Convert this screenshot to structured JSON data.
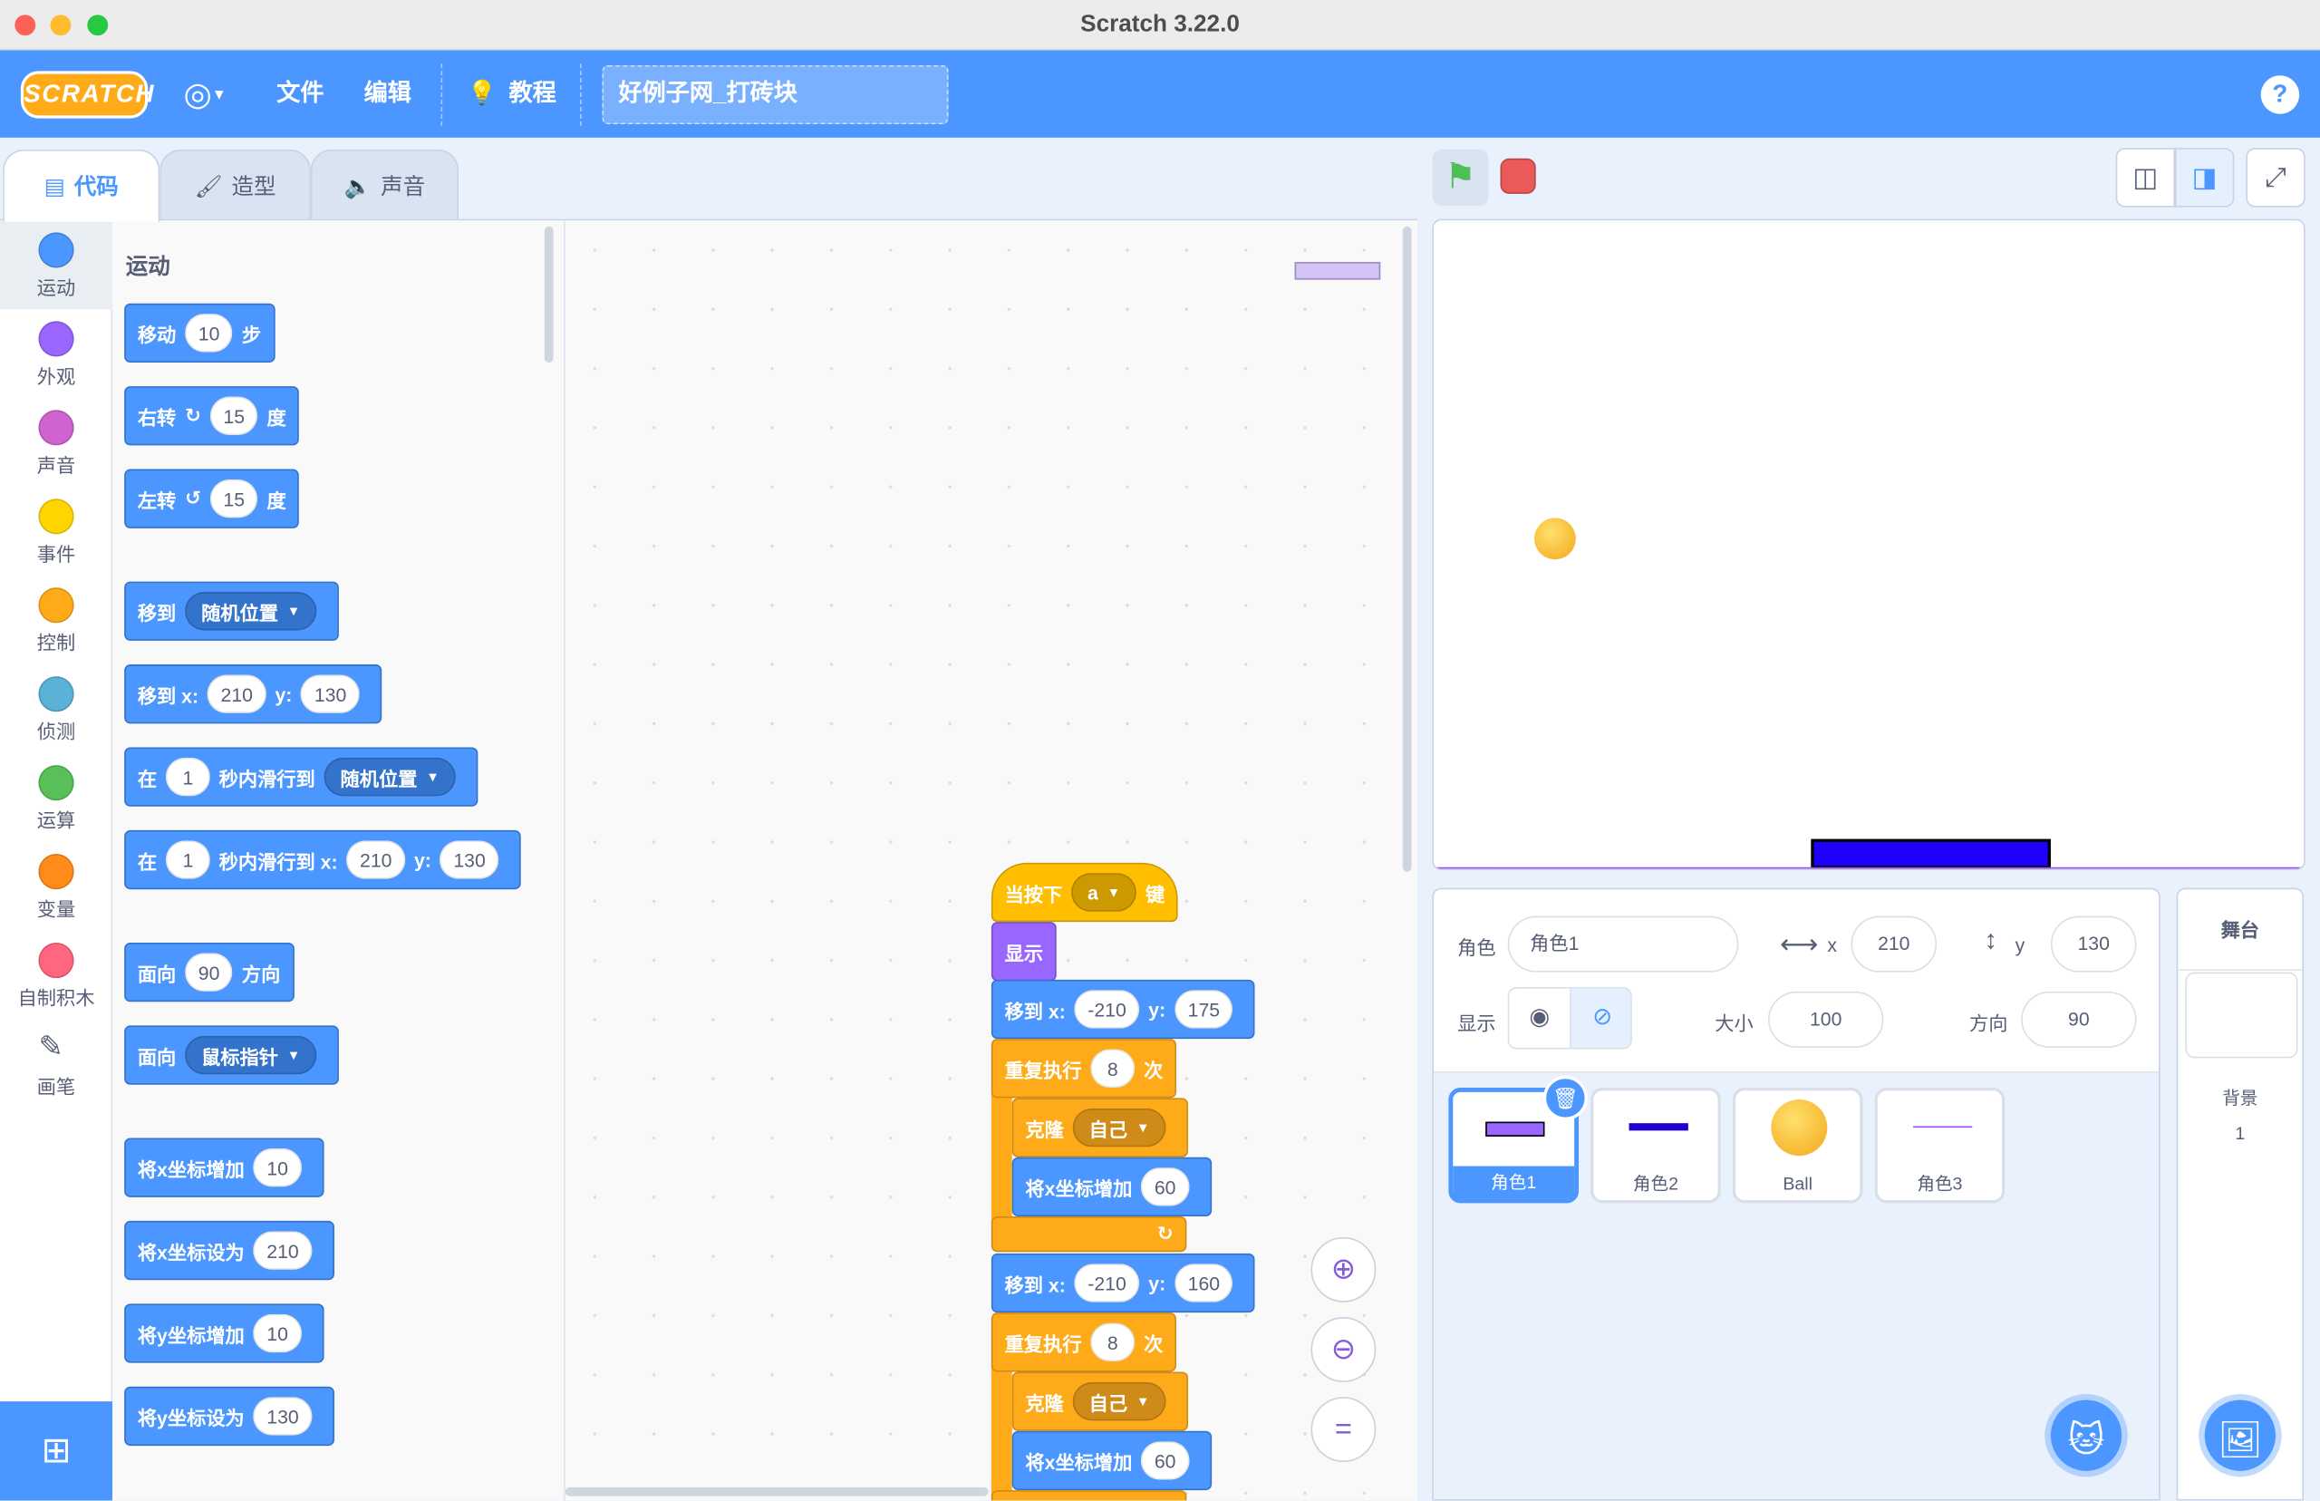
{
  "window": {
    "title": "Scratch 3.22.0"
  },
  "menu": {
    "logo": "SCRATCH",
    "globe_icon": "globe-icon",
    "file": "文件",
    "edit": "编辑",
    "tutorials": "教程",
    "project_title": "好例子网_打砖块",
    "help": "?"
  },
  "tabs": {
    "code": "代码",
    "costumes": "造型",
    "sounds": "声音"
  },
  "categories": [
    {
      "label": "运动",
      "color": "#4c97ff"
    },
    {
      "label": "外观",
      "color": "#9966ff"
    },
    {
      "label": "声音",
      "color": "#cf63cf"
    },
    {
      "label": "事件",
      "color": "#ffd500"
    },
    {
      "label": "控制",
      "color": "#ffab19"
    },
    {
      "label": "侦测",
      "color": "#5cb1d6"
    },
    {
      "label": "运算",
      "color": "#59c059"
    },
    {
      "label": "变量",
      "color": "#ff8c1a"
    },
    {
      "label": "自制积木",
      "color": "#ff6680"
    },
    {
      "label": "画笔",
      "color": "#0fbd8c"
    }
  ],
  "palette": {
    "heading": "运动",
    "move": {
      "a": "移动",
      "v": "10",
      "b": "步"
    },
    "turn_right": {
      "a": "右转",
      "v": "15",
      "b": "度"
    },
    "turn_left": {
      "a": "左转",
      "v": "15",
      "b": "度"
    },
    "goto": {
      "a": "移到",
      "d": "随机位置"
    },
    "goto_xy": {
      "a": "移到 x:",
      "x": "210",
      "y_label": "y:",
      "y": "130"
    },
    "glide": {
      "a": "在",
      "v": "1",
      "b": "秒内滑行到",
      "d": "随机位置"
    },
    "glide_xy": {
      "a": "在",
      "v": "1",
      "b": "秒内滑行到 x:",
      "x": "210",
      "y_label": "y:",
      "y": "130"
    },
    "point_dir": {
      "a": "面向",
      "v": "90",
      "b": "方向"
    },
    "point_towards": {
      "a": "面向",
      "d": "鼠标指针"
    },
    "change_x": {
      "a": "将x坐标增加",
      "v": "10"
    },
    "set_x": {
      "a": "将x坐标设为",
      "v": "210"
    },
    "change_y": {
      "a": "将y坐标增加",
      "v": "10"
    },
    "set_y": {
      "a": "将y坐标设为",
      "v": "130"
    }
  },
  "script": {
    "hat": {
      "a": "当按下",
      "key": "a",
      "b": "键"
    },
    "show": "显示",
    "goto1": {
      "a": "移到 x:",
      "x": "-210",
      "y_label": "y:",
      "y": "175"
    },
    "repeat1": {
      "a": "重复执行",
      "v": "8",
      "b": "次"
    },
    "clone1": {
      "a": "克隆",
      "d": "自己"
    },
    "change_x1": {
      "a": "将x坐标增加",
      "v": "60"
    },
    "goto2": {
      "a": "移到 x:",
      "x": "-210",
      "y_label": "y:",
      "y": "160"
    },
    "repeat2": {
      "a": "重复执行",
      "v": "8",
      "b": "次"
    },
    "clone2": {
      "a": "克隆",
      "d": "自己"
    },
    "change_x2": {
      "a": "将x坐标增加",
      "v": "60"
    }
  },
  "sprite_info": {
    "sprite_label": "角色",
    "sprite_name": "角色1",
    "x_label": "x",
    "x": "210",
    "y_label": "y",
    "y": "130",
    "show_label": "显示",
    "size_label": "大小",
    "size": "100",
    "direction_label": "方向",
    "direction": "90"
  },
  "sprites": [
    {
      "name": "角色1",
      "selected": true
    },
    {
      "name": "角色2",
      "selected": false
    },
    {
      "name": "Ball",
      "selected": false
    },
    {
      "name": "角色3",
      "selected": false
    }
  ],
  "stage_pane": {
    "title": "舞台",
    "backdrop_label": "背景",
    "backdrop_count": "1"
  }
}
